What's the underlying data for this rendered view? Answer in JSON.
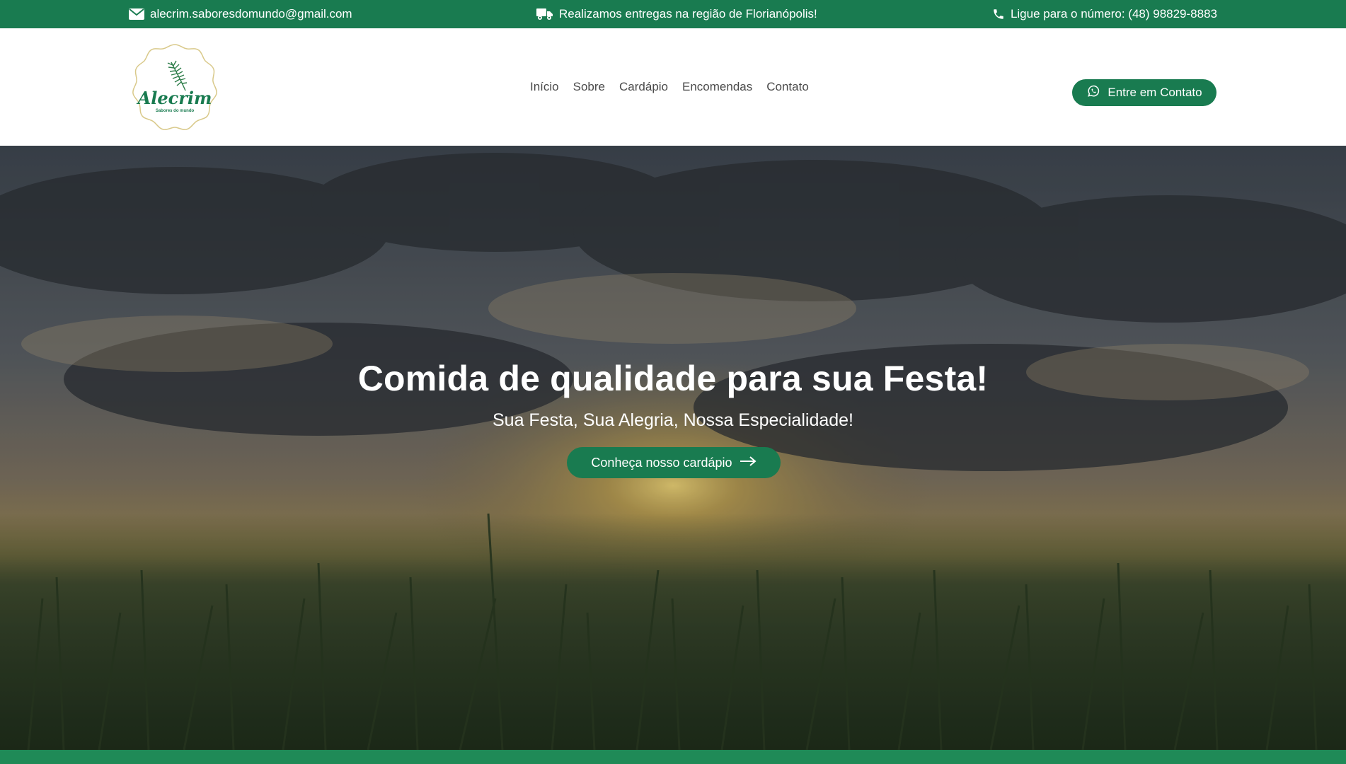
{
  "colors": {
    "brand_green": "#197b50",
    "white": "#ffffff",
    "nav_text": "#4a4a4a"
  },
  "topbar": {
    "email": {
      "icon": "envelope-icon",
      "text": "alecrim.saboresdomundo@gmail.com"
    },
    "delivery": {
      "icon": "truck-icon",
      "text": "Realizamos entregas na região de Florianópolis!"
    },
    "phone": {
      "icon": "phone-icon",
      "text": "Ligue para o número: (48) 98829-8883"
    }
  },
  "header": {
    "logo": {
      "name": "Alecrim",
      "tagline": "Sabores do mundo",
      "icon": "rosemary-sprig-icon"
    },
    "nav": [
      "Início",
      "Sobre",
      "Cardápio",
      "Encomendas",
      "Contato"
    ],
    "cta": {
      "label": "Entre em Contato",
      "icon": "whatsapp-icon"
    }
  },
  "hero": {
    "title": "Comida de qualidade para sua Festa!",
    "subtitle": "Sua Festa, Sua Alegria, Nossa Especialidade!",
    "button": {
      "label": "Conheça nosso cardápio",
      "icon": "arrow-right-icon"
    }
  }
}
